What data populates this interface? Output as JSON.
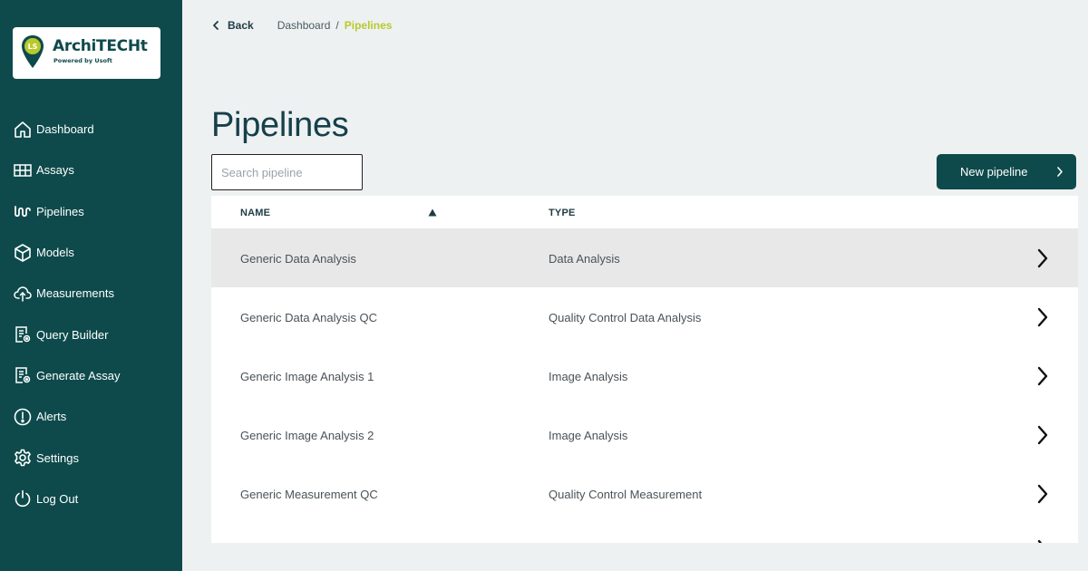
{
  "app": {
    "logo_title": "ArchiTECHt",
    "logo_subtitle": "Powered by Usoft",
    "logo_badge": "LS",
    "brand_color": "#0e4a4c",
    "accent_color": "#b9c92c"
  },
  "sidebar": {
    "items": [
      {
        "label": "Dashboard",
        "icon": "home-icon"
      },
      {
        "label": "Assays",
        "icon": "grid-icon"
      },
      {
        "label": "Pipelines",
        "icon": "pipeline-icon"
      },
      {
        "label": "Models",
        "icon": "cube-icon"
      },
      {
        "label": "Measurements",
        "icon": "cloud-upload-icon"
      },
      {
        "label": "Query Builder",
        "icon": "document-gear-icon"
      },
      {
        "label": "Generate Assay",
        "icon": "document-gear-icon"
      },
      {
        "label": "Alerts",
        "icon": "alert-icon"
      },
      {
        "label": "Settings",
        "icon": "gear-icon"
      },
      {
        "label": "Log Out",
        "icon": "power-icon"
      }
    ]
  },
  "topbar": {
    "back_label": "Back",
    "breadcrumb": {
      "parent": "Dashboard",
      "separator": "/",
      "current": "Pipelines"
    }
  },
  "main": {
    "title": "Pipelines",
    "search_placeholder": "Search pipeline",
    "new_button_label": "New pipeline"
  },
  "table": {
    "columns": {
      "name": "NAME",
      "type": "TYPE"
    },
    "sort": {
      "column": "name",
      "direction": "ascending"
    },
    "rows": [
      {
        "name": "Generic Data Analysis",
        "type": "Data Analysis",
        "selected": true
      },
      {
        "name": "Generic Data Analysis QC",
        "type": "Quality Control Data Analysis",
        "selected": false
      },
      {
        "name": "Generic Image Analysis 1",
        "type": "Image Analysis",
        "selected": false
      },
      {
        "name": "Generic Image Analysis 2",
        "type": "Image Analysis",
        "selected": false
      },
      {
        "name": "Generic Measurement QC",
        "type": "Quality Control Measurement",
        "selected": false
      }
    ]
  }
}
